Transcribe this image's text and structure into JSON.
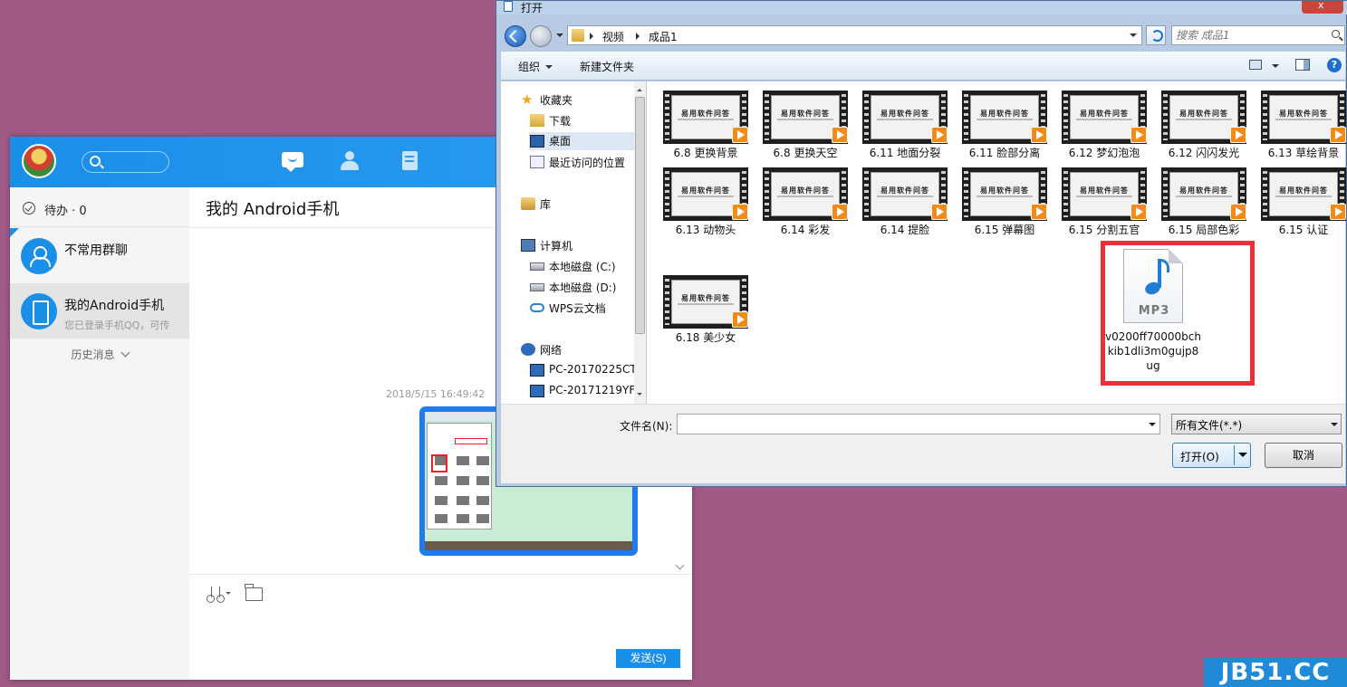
{
  "qq": {
    "todo": "待办 · 0",
    "conversations": [
      {
        "name": "不常用群聊",
        "preview": ""
      },
      {
        "name": "我的Android手机",
        "preview": "您已登录手机QQ，可传"
      }
    ],
    "history": "历史消息",
    "chat_title": "我的 Android手机",
    "timestamp": "2018/5/15 16:49:42",
    "send_label": "发送(S)"
  },
  "dialog": {
    "title": "打开",
    "breadcrumb": [
      "视频",
      "成品1"
    ],
    "search_placeholder": "搜索 成品1",
    "organize": "组织",
    "new_folder": "新建文件夹",
    "help": "?",
    "nav": [
      {
        "label": "收藏夹",
        "icon": "star-icon"
      },
      {
        "label": "下载",
        "icon": "folder-icon"
      },
      {
        "label": "桌面",
        "icon": "desktop-icon"
      },
      {
        "label": "最近访问的位置",
        "icon": "recent-icon"
      },
      {
        "label": "库",
        "icon": "library-icon"
      },
      {
        "label": "计算机",
        "icon": "computer-icon"
      },
      {
        "label": "本地磁盘 (C:)",
        "icon": "disk-icon"
      },
      {
        "label": "本地磁盘 (D:)",
        "icon": "disk-icon"
      },
      {
        "label": "WPS云文档",
        "icon": "cloud-icon"
      },
      {
        "label": "网络",
        "icon": "network-icon"
      },
      {
        "label": "PC-20170225CT",
        "icon": "pc-icon"
      },
      {
        "label": "PC-20171219YF",
        "icon": "pc-icon"
      }
    ],
    "thumb_text": "易用软件问答",
    "files": [
      "6.8 更换背景",
      "6.8 更换天空",
      "6.11 地面分裂",
      "6.11 脸部分离",
      "6.12 梦幻泡泡",
      "6.12 闪闪发光",
      "6.13 草绘背景",
      "6.13 动物头",
      "6.14 彩发",
      "6.14 提脸",
      "6.15 弹幕图",
      "6.15 分割五官",
      "6.15 局部色彩",
      "6.15 认证",
      "6.18 美少女"
    ],
    "mp3": {
      "badge": "MP3",
      "name": "v0200ff70000bchkib1dli3m0gujp8ug"
    },
    "filename_label": "文件名(N):",
    "filename_value": "",
    "filetype": "所有文件(*.*)",
    "open_label": "打开(O)",
    "cancel_label": "取消"
  },
  "watermark": "JB51.CC"
}
